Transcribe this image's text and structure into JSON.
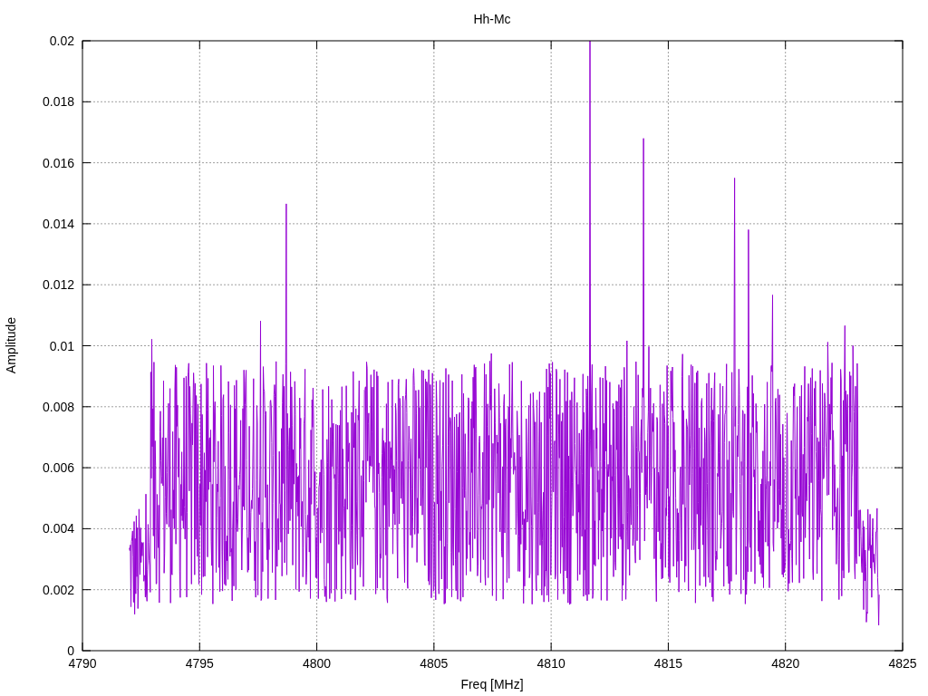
{
  "plot": {
    "title": "Hh-Mc",
    "xlabel": "Freq [MHz]",
    "ylabel": "Amplitude",
    "xticks": [
      "4790",
      "4795",
      "4800",
      "4805",
      "4810",
      "4815",
      "4820",
      "4825"
    ],
    "yticks": [
      "0.02",
      "0.018",
      "0.016",
      "0.014",
      "0.012",
      "0.01",
      "0.008",
      "0.006",
      "0.004",
      "0.002",
      "0"
    ]
  }
}
